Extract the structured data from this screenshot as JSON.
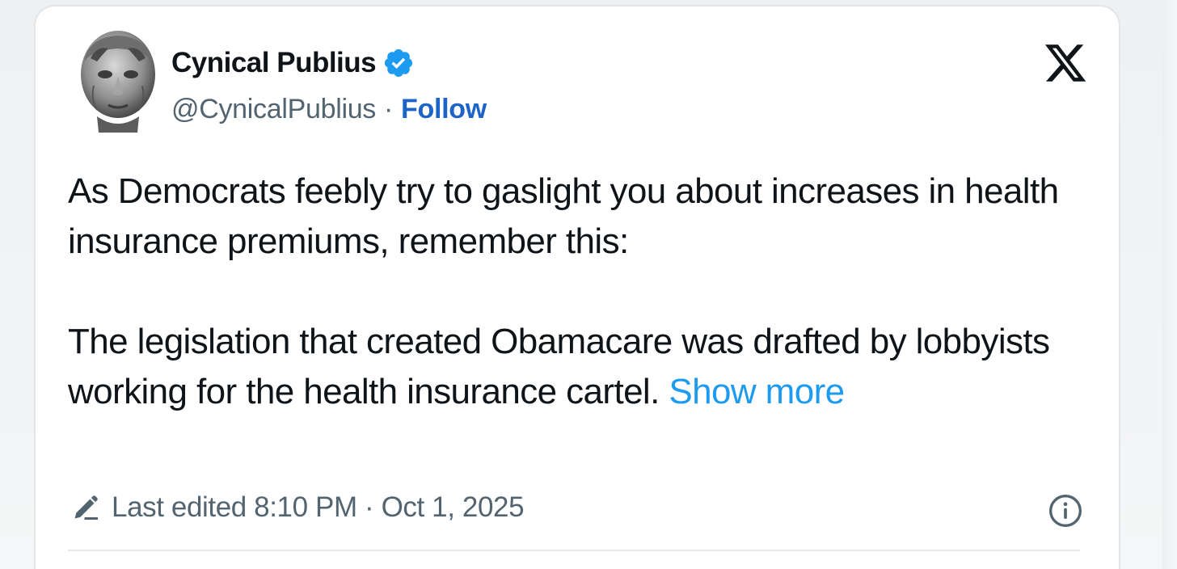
{
  "tweet": {
    "author": {
      "display_name": "Cynical Publius",
      "handle": "@CynicalPublius",
      "verified": true,
      "avatar_icon": "classical-bust-avatar"
    },
    "separator": "·",
    "follow_label": "Follow",
    "platform_icon": "x-logo-icon",
    "paragraphs": [
      "As Democrats feebly try to gaslight you about increases in health insurance premiums, remember this:",
      "The legislation that created Obamacare was drafted by lobbyists working for the health insurance cartel."
    ],
    "show_more_label": "Show more",
    "edited_label": "Last edited 8:10 PM · Oct 1, 2025",
    "info_icon": "info-icon"
  },
  "colors": {
    "link_blue": "#1d9bf0",
    "follow_blue": "#1d64c8",
    "text": "#0f1419",
    "muted": "#536471",
    "verified_blue": "#1d9bf0"
  }
}
